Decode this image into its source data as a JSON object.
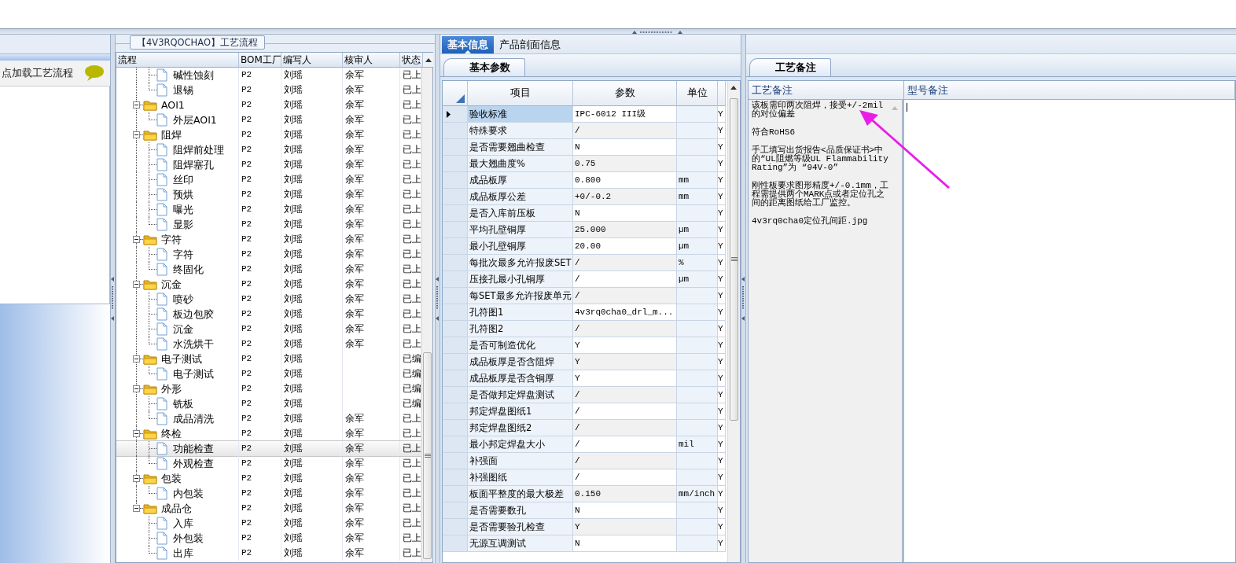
{
  "left_panel": {
    "hint": "点加载工艺流程"
  },
  "flow": {
    "title": "【4V3RQOCHAO】工艺流程",
    "columns": [
      "流程",
      "BOM工厂",
      "编写人",
      "核审人",
      "状态"
    ],
    "nodes": [
      {
        "kind": "leaf",
        "label": "碱性蚀刻",
        "bom": "P2",
        "author": "刘瑶",
        "reviewer": "余军",
        "status": "已上",
        "selected": false
      },
      {
        "kind": "leaf",
        "label": "退锡",
        "bom": "P2",
        "author": "刘瑶",
        "reviewer": "余军",
        "status": "已上",
        "selected": false
      },
      {
        "kind": "folder",
        "label": "AOI1",
        "bom": "P2",
        "author": "刘瑶",
        "reviewer": "余军",
        "status": "已上",
        "selected": false,
        "expanded": true,
        "children": [
          {
            "kind": "leaf",
            "label": "外层AOI1",
            "bom": "P2",
            "author": "刘瑶",
            "reviewer": "余军",
            "status": "已上",
            "selected": false
          }
        ]
      },
      {
        "kind": "folder",
        "label": "阻焊",
        "bom": "P2",
        "author": "刘瑶",
        "reviewer": "余军",
        "status": "已上",
        "selected": false,
        "expanded": true,
        "children": [
          {
            "kind": "leaf",
            "label": "阻焊前处理",
            "bom": "P2",
            "author": "刘瑶",
            "reviewer": "余军",
            "status": "已上",
            "selected": false
          },
          {
            "kind": "leaf",
            "label": "阻焊塞孔",
            "bom": "P2",
            "author": "刘瑶",
            "reviewer": "余军",
            "status": "已上",
            "selected": false
          },
          {
            "kind": "leaf",
            "label": "丝印",
            "bom": "P2",
            "author": "刘瑶",
            "reviewer": "余军",
            "status": "已上",
            "selected": false
          },
          {
            "kind": "leaf",
            "label": "预烘",
            "bom": "P2",
            "author": "刘瑶",
            "reviewer": "余军",
            "status": "已上",
            "selected": false
          },
          {
            "kind": "leaf",
            "label": "曝光",
            "bom": "P2",
            "author": "刘瑶",
            "reviewer": "余军",
            "status": "已上",
            "selected": false
          },
          {
            "kind": "leaf",
            "label": "显影",
            "bom": "P2",
            "author": "刘瑶",
            "reviewer": "余军",
            "status": "已上",
            "selected": false
          }
        ]
      },
      {
        "kind": "folder",
        "label": "字符",
        "bom": "P2",
        "author": "刘瑶",
        "reviewer": "余军",
        "status": "已上",
        "selected": false,
        "expanded": true,
        "children": [
          {
            "kind": "leaf",
            "label": "字符",
            "bom": "P2",
            "author": "刘瑶",
            "reviewer": "余军",
            "status": "已上",
            "selected": false
          },
          {
            "kind": "leaf",
            "label": "终固化",
            "bom": "P2",
            "author": "刘瑶",
            "reviewer": "余军",
            "status": "已上",
            "selected": false
          }
        ]
      },
      {
        "kind": "folder",
        "label": "沉金",
        "bom": "P2",
        "author": "刘瑶",
        "reviewer": "余军",
        "status": "已上",
        "selected": false,
        "expanded": true,
        "children": [
          {
            "kind": "leaf",
            "label": "喷砂",
            "bom": "P2",
            "author": "刘瑶",
            "reviewer": "余军",
            "status": "已上",
            "selected": false
          },
          {
            "kind": "leaf",
            "label": "板边包胶",
            "bom": "P2",
            "author": "刘瑶",
            "reviewer": "余军",
            "status": "已上",
            "selected": false
          },
          {
            "kind": "leaf",
            "label": "沉金",
            "bom": "P2",
            "author": "刘瑶",
            "reviewer": "余军",
            "status": "已上",
            "selected": false
          },
          {
            "kind": "leaf",
            "label": "水洗烘干",
            "bom": "P2",
            "author": "刘瑶",
            "reviewer": "余军",
            "status": "已上",
            "selected": false
          }
        ]
      },
      {
        "kind": "folder",
        "label": "电子测试",
        "bom": "P2",
        "author": "刘瑶",
        "status": "已编",
        "selected": false,
        "expanded": true,
        "children": [
          {
            "kind": "leaf",
            "label": "电子测试",
            "bom": "P2",
            "author": "刘瑶",
            "status": "已编",
            "selected": false
          }
        ]
      },
      {
        "kind": "folder",
        "label": "外形",
        "bom": "P2",
        "author": "刘瑶",
        "status": "已编",
        "selected": false,
        "expanded": true,
        "children": [
          {
            "kind": "leaf",
            "label": "铣板",
            "bom": "P2",
            "author": "刘瑶",
            "status": "已编",
            "selected": false
          },
          {
            "kind": "leaf",
            "label": "成品清洗",
            "bom": "P2",
            "author": "刘瑶",
            "reviewer": "余军",
            "status": "已上",
            "selected": false
          }
        ]
      },
      {
        "kind": "folder",
        "label": "终检",
        "bom": "P2",
        "author": "刘瑶",
        "reviewer": "余军",
        "status": "已上",
        "selected": false,
        "expanded": true,
        "children": [
          {
            "kind": "leaf",
            "label": "功能检查",
            "bom": "P2",
            "author": "刘瑶",
            "reviewer": "余军",
            "status": "已上",
            "selected": true
          },
          {
            "kind": "leaf",
            "label": "外观检查",
            "bom": "P2",
            "author": "刘瑶",
            "reviewer": "余军",
            "status": "已上",
            "selected": false
          }
        ]
      },
      {
        "kind": "folder",
        "label": "包装",
        "bom": "P2",
        "author": "刘瑶",
        "reviewer": "余军",
        "status": "已上",
        "selected": false,
        "expanded": true,
        "children": [
          {
            "kind": "leaf",
            "label": "内包装",
            "bom": "P2",
            "author": "刘瑶",
            "reviewer": "余军",
            "status": "已上",
            "selected": false
          }
        ]
      },
      {
        "kind": "folder",
        "label": "成品仓",
        "bom": "P2",
        "author": "刘瑶",
        "reviewer": "余军",
        "status": "已上",
        "selected": false,
        "expanded": true,
        "children": [
          {
            "kind": "leaf",
            "label": "入库",
            "bom": "P2",
            "author": "刘瑶",
            "reviewer": "余军",
            "status": "已上",
            "selected": false
          },
          {
            "kind": "leaf",
            "label": "外包装",
            "bom": "P2",
            "author": "刘瑶",
            "reviewer": "余军",
            "status": "已上",
            "selected": false
          },
          {
            "kind": "leaf",
            "label": "出库",
            "bom": "P2",
            "author": "刘瑶",
            "reviewer": "余军",
            "status": "已上",
            "selected": false
          }
        ]
      }
    ]
  },
  "tabs": [
    {
      "label": "基本信息",
      "selected": true
    },
    {
      "label": "产品剖面信息",
      "selected": false
    }
  ],
  "sub_tabs": [
    {
      "label": "基本参数",
      "selected": true
    }
  ],
  "params": {
    "columns": [
      "项目",
      "参数",
      "单位"
    ],
    "rows": [
      {
        "item": "验收标准",
        "value": "IPC-6012 III级",
        "column_4": "Y",
        "selected": true
      },
      {
        "item": "特殊要求",
        "value": "/",
        "column_4": "Y",
        "selected": false
      },
      {
        "item": "是否需要翘曲检查",
        "value": "N",
        "column_4": "Y",
        "selected": false
      },
      {
        "item": "最大翘曲度%",
        "value": "0.75",
        "column_4": "Y",
        "selected": false
      },
      {
        "item": "成品板厚",
        "value": "0.800",
        "unit": "mm",
        "column_4": "Y",
        "selected": false
      },
      {
        "item": "成品板厚公差",
        "value": "+0/-0.2",
        "unit": "mm",
        "column_4": "Y",
        "selected": false
      },
      {
        "item": "是否入库前压板",
        "value": "N",
        "column_4": "Y",
        "selected": false
      },
      {
        "item": "平均孔壁铜厚",
        "value": "25.000",
        "unit": "µm",
        "column_4": "Y",
        "selected": false
      },
      {
        "item": "最小孔壁铜厚",
        "value": "20.00",
        "unit": "µm",
        "column_4": "Y",
        "selected": false
      },
      {
        "item": "每批次最多允许报废SET",
        "value": "/",
        "unit": "%",
        "column_4": "Y",
        "selected": false
      },
      {
        "item": "压接孔最小孔铜厚",
        "value": "/",
        "unit": "µm",
        "column_4": "Y",
        "selected": false
      },
      {
        "item": "每SET最多允许报废单元",
        "value": "/",
        "column_4": "Y",
        "selected": false
      },
      {
        "item": "孔符图1",
        "value": "4v3rq0cha0_drl_m...",
        "column_4": "Y",
        "selected": false
      },
      {
        "item": "孔符图2",
        "value": "/",
        "column_4": "Y",
        "selected": false
      },
      {
        "item": "是否可制造优化",
        "value": "Y",
        "column_4": "Y",
        "selected": false
      },
      {
        "item": "成品板厚是否含阻焊",
        "value": "Y",
        "column_4": "Y",
        "selected": false
      },
      {
        "item": "成品板厚是否含铜厚",
        "value": "Y",
        "column_4": "Y",
        "selected": false
      },
      {
        "item": "是否做邦定焊盘测试",
        "value": "/",
        "column_4": "Y",
        "selected": false
      },
      {
        "item": "邦定焊盘图纸1",
        "value": "/",
        "column_4": "Y",
        "selected": false
      },
      {
        "item": "邦定焊盘图纸2",
        "value": "/",
        "column_4": "Y",
        "selected": false
      },
      {
        "item": "最小邦定焊盘大小",
        "value": "/",
        "unit": "mil",
        "column_4": "Y",
        "selected": false
      },
      {
        "item": "补强面",
        "value": "/",
        "column_4": "Y",
        "selected": false
      },
      {
        "item": "补强图纸",
        "value": "/",
        "column_4": "Y",
        "selected": false
      },
      {
        "item": "板面平整度的最大极差",
        "value": "0.150",
        "unit": "mm/inch",
        "column_4": "Y",
        "selected": false
      },
      {
        "item": "是否需要数孔",
        "value": "N",
        "column_4": "Y",
        "selected": false
      },
      {
        "item": "是否需要验孔检查",
        "value": "Y",
        "column_4": "Y",
        "selected": false
      },
      {
        "item": "无源互调测试",
        "value": "N",
        "column_4": "Y",
        "selected": false
      }
    ]
  },
  "remarks": {
    "tabs": [
      {
        "label": "工艺备注",
        "selected": true
      }
    ],
    "columns": [
      "工艺备注",
      "型号备注"
    ],
    "process_notes": [
      "该板需印两次阻焊，接受+/-2mil的对位偏差",
      "符合RoHS6",
      "手工填写出货报告<品质保证书>中的“UL阻燃等级UL Flammability Rating”为 “94V-0”",
      "刚性板要求图形精度+/-0.1mm，工程需提供两个MARK点或者定位孔之间的距离图纸给工厂监控。",
      "4v3rq0cha0定位孔间距.jpg"
    ]
  }
}
